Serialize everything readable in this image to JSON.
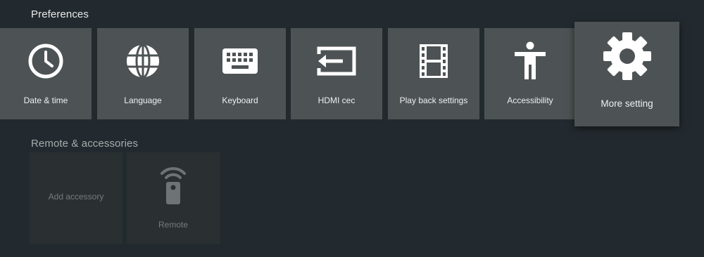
{
  "preferences": {
    "title": "Preferences",
    "tiles": [
      {
        "label": "Date & time",
        "icon": "clock-icon"
      },
      {
        "label": "Language",
        "icon": "globe-icon"
      },
      {
        "label": "Keyboard",
        "icon": "keyboard-icon"
      },
      {
        "label": "HDMI cec",
        "icon": "hdmi-input-icon"
      },
      {
        "label": "Play back settings",
        "icon": "film-strip-icon"
      },
      {
        "label": "Accessibility",
        "icon": "accessibility-icon"
      },
      {
        "label": "More setting",
        "icon": "gear-icon",
        "focused": true
      }
    ]
  },
  "remote": {
    "title": "Remote & accessories",
    "tiles": [
      {
        "label": "Add accessory"
      },
      {
        "label": "Remote",
        "icon": "remote-control-icon"
      }
    ]
  },
  "colors": {
    "background": "#232a2f",
    "tile": "#4d5354",
    "tile_disabled": "#2a3032",
    "text": "#eef0f0",
    "text_dim": "#767b7d"
  }
}
